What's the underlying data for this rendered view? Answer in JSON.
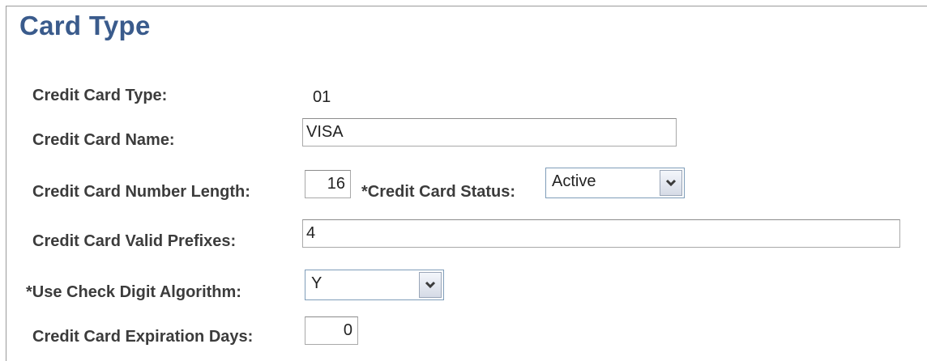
{
  "page": {
    "title": "Card Type"
  },
  "form": {
    "card_type": {
      "label": "Credit Card Type:",
      "value": "01"
    },
    "card_name": {
      "label": "Credit Card Name:",
      "value": "VISA"
    },
    "number_length": {
      "label": "Credit Card Number Length:",
      "value": "16"
    },
    "card_status": {
      "label": "*Credit Card Status:",
      "value": "Active"
    },
    "valid_prefixes": {
      "label": "Credit Card Valid Prefixes:",
      "value": "4"
    },
    "check_digit": {
      "label": "*Use Check Digit Algorithm:",
      "value": "Y"
    },
    "expiration_days": {
      "label": "Credit Card Expiration Days:",
      "value": "0"
    }
  },
  "icons": {
    "dropdown": "chevron-down-icon"
  },
  "colors": {
    "title": "#3a5b8c",
    "label": "#3c3c3c",
    "field_border": "#a9a9a9",
    "select_border": "#7f9db9"
  }
}
